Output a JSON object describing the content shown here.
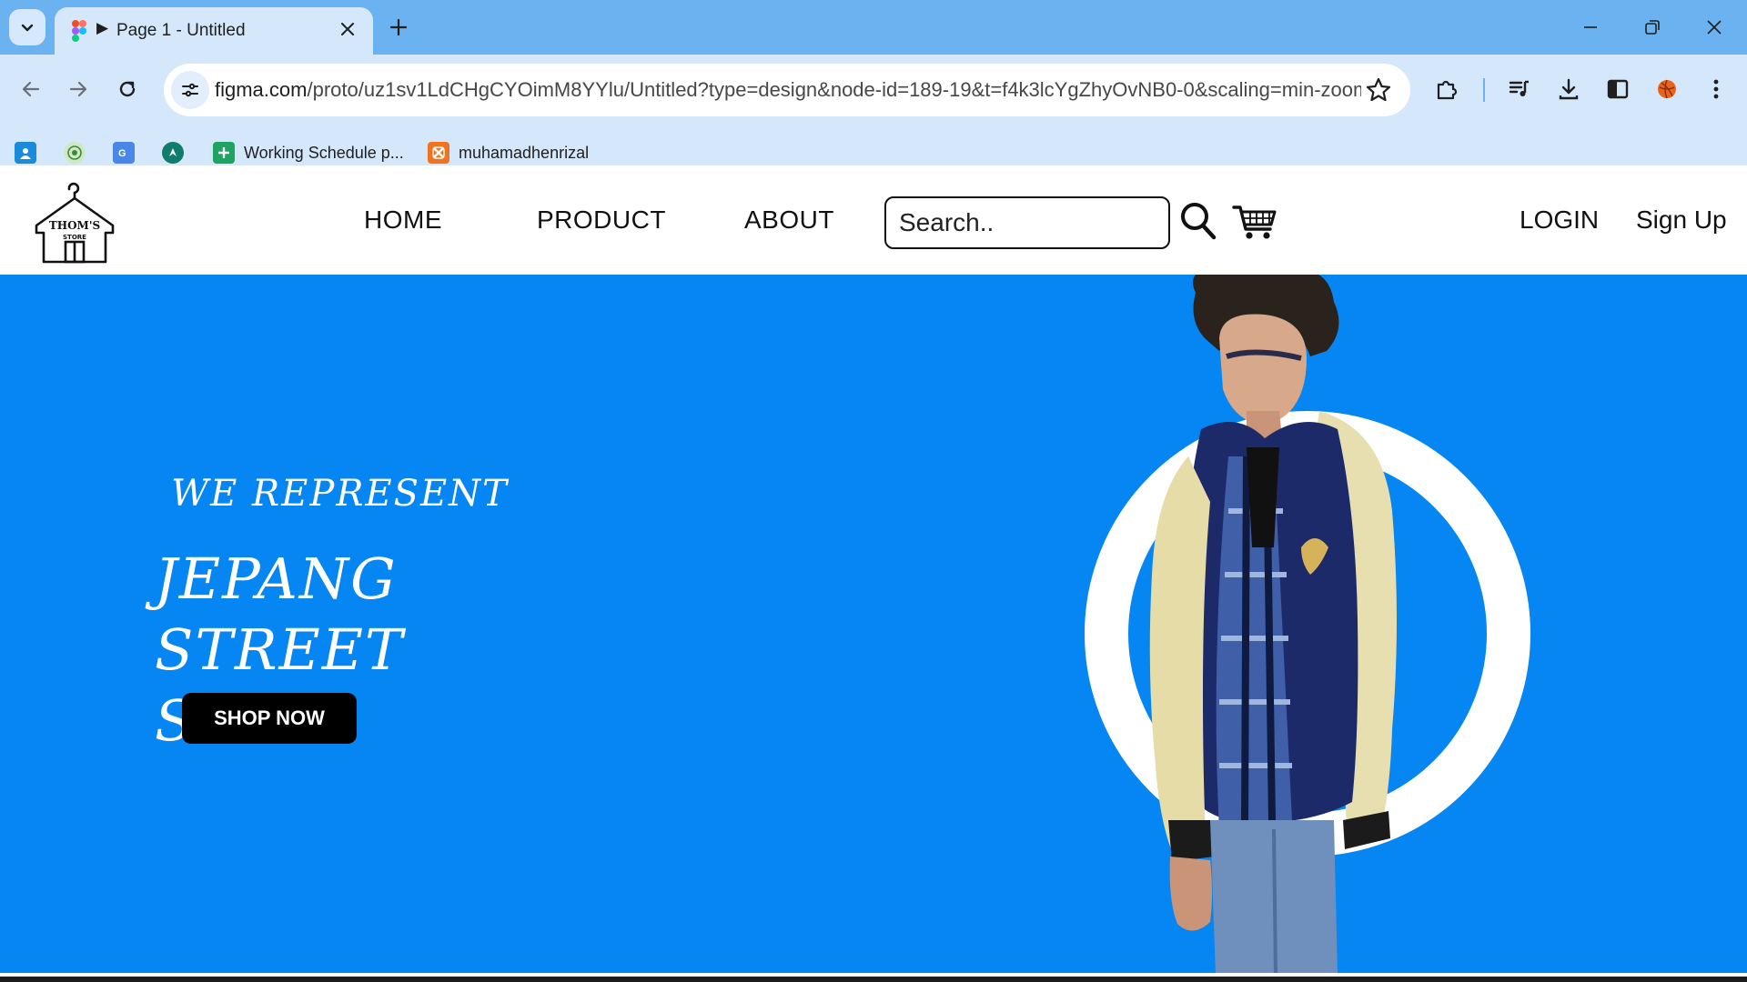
{
  "browser": {
    "tab": {
      "play_glyph": "▶",
      "title": "Page 1 - Untitled"
    },
    "address_bar": {
      "domain": "figma.com",
      "path": "/proto/uz1sv1LdCHgCYOimM8YYlu/Untitled?type=design&node-id=189-19&t=f4k3lcYgZhyOvNB0-0&scaling=min-zoom..."
    },
    "bookmarks": [
      {
        "icon": "contacts-icon",
        "label": ""
      },
      {
        "icon": "globe-seal-icon",
        "label": ""
      },
      {
        "icon": "translate-icon",
        "label": ""
      },
      {
        "icon": "compass-icon",
        "label": ""
      },
      {
        "icon": "sheets-icon",
        "label": "Working Schedule p..."
      },
      {
        "icon": "xampp-icon",
        "label": "muhamadhenrizal"
      }
    ],
    "accent_color": "#6bb2f0",
    "toolbar_color": "#d5e7fb"
  },
  "site": {
    "logo": {
      "line1": "THOM'S",
      "line2": "STORE"
    },
    "nav": [
      "HOME",
      "PRODUCT",
      "ABOUT"
    ],
    "search": {
      "placeholder": "Search.."
    },
    "auth": {
      "login": "LOGIN",
      "signup": "Sign Up"
    },
    "hero": {
      "subtitle": "WE REPRESENT",
      "title": "JEPANG STREET STYLE",
      "cta": "SHOP NOW",
      "background_color": "#0586f2"
    }
  }
}
